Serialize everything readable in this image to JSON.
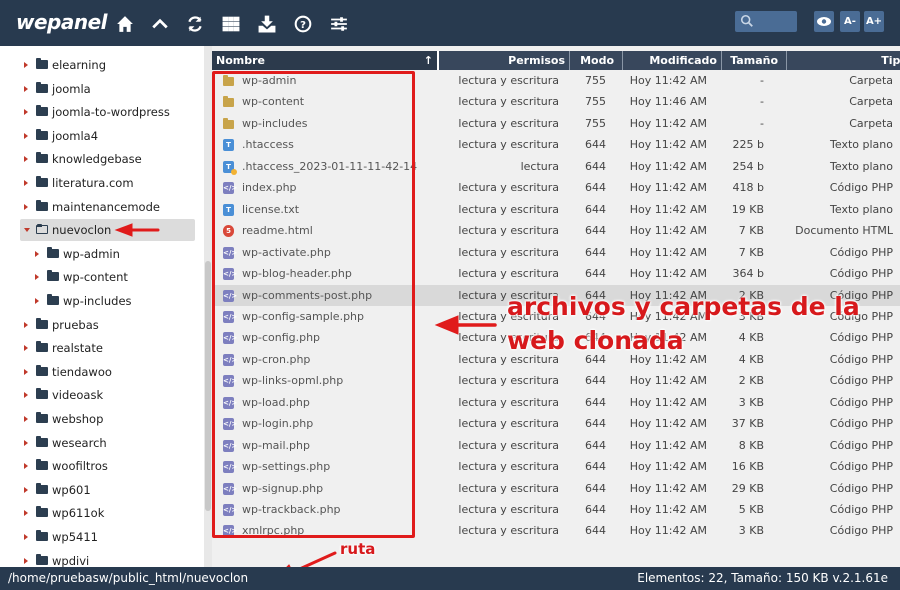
{
  "app": {
    "logo": "wepanel"
  },
  "toolbar": {
    "icons": [
      "home-icon",
      "chevron-up-icon",
      "refresh-icon",
      "grid-icon",
      "download-icon",
      "help-icon",
      "settings-sliders-icon"
    ],
    "search_placeholder": "",
    "font_decrease_label": "A-",
    "font_increase_label": "A+"
  },
  "sidebar": {
    "items": [
      {
        "label": "elearning",
        "level": 0,
        "expanded": false
      },
      {
        "label": "joomla",
        "level": 0,
        "expanded": false
      },
      {
        "label": "joomla-to-wordpress",
        "level": 0,
        "expanded": false
      },
      {
        "label": "joomla4",
        "level": 0,
        "expanded": false
      },
      {
        "label": "knowledgebase",
        "level": 0,
        "expanded": false
      },
      {
        "label": "literatura.com",
        "level": 0,
        "expanded": false
      },
      {
        "label": "maintenancemode",
        "level": 0,
        "expanded": false
      },
      {
        "label": "nuevoclon",
        "level": 0,
        "expanded": true,
        "selected": true
      },
      {
        "label": "wp-admin",
        "level": 1,
        "expanded": false
      },
      {
        "label": "wp-content",
        "level": 1,
        "expanded": false
      },
      {
        "label": "wp-includes",
        "level": 1,
        "expanded": false
      },
      {
        "label": "pruebas",
        "level": 0,
        "expanded": false
      },
      {
        "label": "realstate",
        "level": 0,
        "expanded": false
      },
      {
        "label": "tiendawoo",
        "level": 0,
        "expanded": false
      },
      {
        "label": "videoask",
        "level": 0,
        "expanded": false
      },
      {
        "label": "webshop",
        "level": 0,
        "expanded": false
      },
      {
        "label": "wesearch",
        "level": 0,
        "expanded": false
      },
      {
        "label": "woofiltros",
        "level": 0,
        "expanded": false
      },
      {
        "label": "wp601",
        "level": 0,
        "expanded": false
      },
      {
        "label": "wp611ok",
        "level": 0,
        "expanded": false
      },
      {
        "label": "wp5411",
        "level": 0,
        "expanded": false
      },
      {
        "label": "wpdivi",
        "level": 0,
        "expanded": false
      }
    ]
  },
  "table": {
    "headers": {
      "name": "Nombre",
      "name_sort": "↑",
      "perm": "Permisos",
      "mode": "Modo",
      "mod": "Modificado",
      "size": "Tamaño",
      "type": "Tipo"
    },
    "rows": [
      {
        "icon": "folder",
        "name": "wp-admin",
        "perm": "lectura y escritura",
        "mode": "755",
        "mod": "Hoy 11:42 AM",
        "size": "-",
        "type": "Carpeta"
      },
      {
        "icon": "folder",
        "name": "wp-content",
        "perm": "lectura y escritura",
        "mode": "755",
        "mod": "Hoy 11:46 AM",
        "size": "-",
        "type": "Carpeta"
      },
      {
        "icon": "folder",
        "name": "wp-includes",
        "perm": "lectura y escritura",
        "mode": "755",
        "mod": "Hoy 11:42 AM",
        "size": "-",
        "type": "Carpeta"
      },
      {
        "icon": "text",
        "name": ".htaccess",
        "perm": "lectura y escritura",
        "mode": "644",
        "mod": "Hoy 11:42 AM",
        "size": "225 b",
        "type": "Texto plano"
      },
      {
        "icon": "text-locked",
        "name": ".htaccess_2023-01-11-11-42-14",
        "perm": "lectura",
        "mode": "644",
        "mod": "Hoy 11:42 AM",
        "size": "254 b",
        "type": "Texto plano"
      },
      {
        "icon": "php",
        "name": "index.php",
        "perm": "lectura y escritura",
        "mode": "644",
        "mod": "Hoy 11:42 AM",
        "size": "418 b",
        "type": "Código PHP"
      },
      {
        "icon": "text",
        "name": "license.txt",
        "perm": "lectura y escritura",
        "mode": "644",
        "mod": "Hoy 11:42 AM",
        "size": "19 KB",
        "type": "Texto plano"
      },
      {
        "icon": "html",
        "name": "readme.html",
        "perm": "lectura y escritura",
        "mode": "644",
        "mod": "Hoy 11:42 AM",
        "size": "7 KB",
        "type": "Documento HTML"
      },
      {
        "icon": "php",
        "name": "wp-activate.php",
        "perm": "lectura y escritura",
        "mode": "644",
        "mod": "Hoy 11:42 AM",
        "size": "7 KB",
        "type": "Código PHP"
      },
      {
        "icon": "php",
        "name": "wp-blog-header.php",
        "perm": "lectura y escritura",
        "mode": "644",
        "mod": "Hoy 11:42 AM",
        "size": "364 b",
        "type": "Código PHP"
      },
      {
        "icon": "php",
        "name": "wp-comments-post.php",
        "perm": "lectura y escritura",
        "mode": "644",
        "mod": "Hoy 11:42 AM",
        "size": "2 KB",
        "type": "Código PHP",
        "hover": true
      },
      {
        "icon": "php",
        "name": "wp-config-sample.php",
        "perm": "lectura y escritura",
        "mode": "644",
        "mod": "Hoy 11:42 AM",
        "size": "3 KB",
        "type": "Código PHP"
      },
      {
        "icon": "php",
        "name": "wp-config.php",
        "perm": "lectura y escritura",
        "mode": "644",
        "mod": "Hoy 11:42 AM",
        "size": "4 KB",
        "type": "Código PHP"
      },
      {
        "icon": "php",
        "name": "wp-cron.php",
        "perm": "lectura y escritura",
        "mode": "644",
        "mod": "Hoy 11:42 AM",
        "size": "4 KB",
        "type": "Código PHP"
      },
      {
        "icon": "php",
        "name": "wp-links-opml.php",
        "perm": "lectura y escritura",
        "mode": "644",
        "mod": "Hoy 11:42 AM",
        "size": "2 KB",
        "type": "Código PHP"
      },
      {
        "icon": "php",
        "name": "wp-load.php",
        "perm": "lectura y escritura",
        "mode": "644",
        "mod": "Hoy 11:42 AM",
        "size": "3 KB",
        "type": "Código PHP"
      },
      {
        "icon": "php",
        "name": "wp-login.php",
        "perm": "lectura y escritura",
        "mode": "644",
        "mod": "Hoy 11:42 AM",
        "size": "37 KB",
        "type": "Código PHP"
      },
      {
        "icon": "php",
        "name": "wp-mail.php",
        "perm": "lectura y escritura",
        "mode": "644",
        "mod": "Hoy 11:42 AM",
        "size": "8 KB",
        "type": "Código PHP"
      },
      {
        "icon": "php",
        "name": "wp-settings.php",
        "perm": "lectura y escritura",
        "mode": "644",
        "mod": "Hoy 11:42 AM",
        "size": "16 KB",
        "type": "Código PHP"
      },
      {
        "icon": "php",
        "name": "wp-signup.php",
        "perm": "lectura y escritura",
        "mode": "644",
        "mod": "Hoy 11:42 AM",
        "size": "29 KB",
        "type": "Código PHP"
      },
      {
        "icon": "php",
        "name": "wp-trackback.php",
        "perm": "lectura y escritura",
        "mode": "644",
        "mod": "Hoy 11:42 AM",
        "size": "5 KB",
        "type": "Código PHP"
      },
      {
        "icon": "php",
        "name": "xmlrpc.php",
        "perm": "lectura y escritura",
        "mode": "644",
        "mod": "Hoy 11:42 AM",
        "size": "3 KB",
        "type": "Código PHP"
      }
    ]
  },
  "annotations": {
    "main_line1": "archivos y carpetas de la",
    "main_line2": "web clonada",
    "path_label": "ruta"
  },
  "status": {
    "path": "/home/pruebasw/public_html/nuevoclon",
    "stats": "Elementos: 22, Tamaño: 150 KB v.2.1.61e"
  },
  "colors": {
    "topbar": "#283a4f",
    "accent_red": "#e01b1b",
    "folder": "#c8a44a",
    "php": "#7d7fbf",
    "text": "#4a8fd6"
  }
}
